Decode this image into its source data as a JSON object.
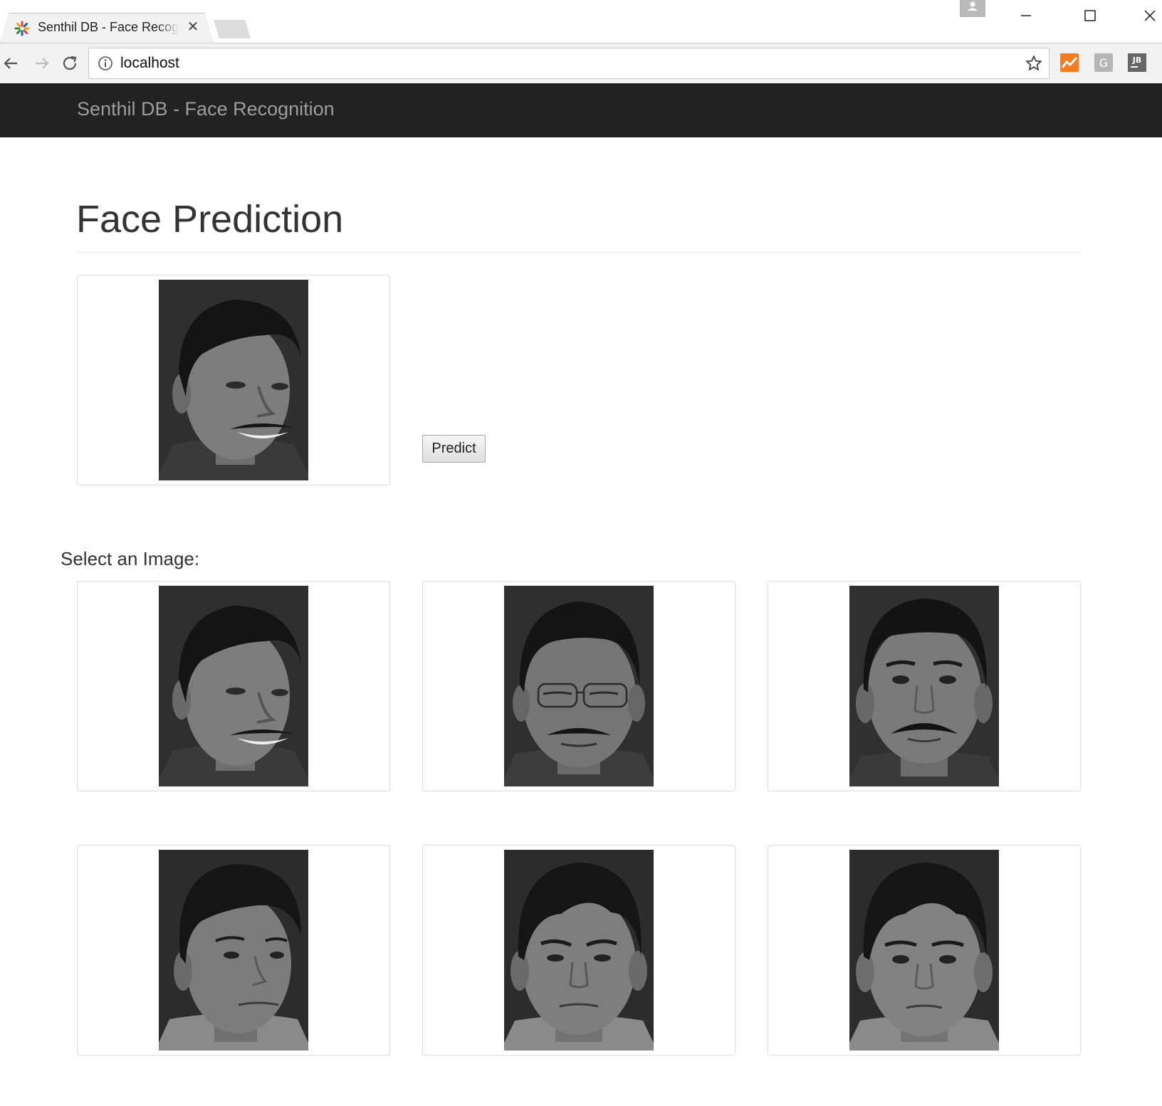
{
  "browser": {
    "tab_title": "Senthil DB - Face Recognition",
    "url": "localhost"
  },
  "navbar": {
    "brand": "Senthil DB - Face Recognition"
  },
  "page": {
    "title": "Face Prediction",
    "predict_button": "Predict",
    "select_label": "Select an Image:"
  },
  "selected_image": {
    "icon": "face-photo-smiling-turned"
  },
  "gallery": [
    {
      "icon": "face-photo-smiling-turned"
    },
    {
      "icon": "face-photo-glasses-eyes-closed"
    },
    {
      "icon": "face-photo-frontal-mustache"
    },
    {
      "icon": "face-photo-young-turned"
    },
    {
      "icon": "face-photo-young-frown"
    },
    {
      "icon": "face-photo-young-frontal"
    }
  ]
}
